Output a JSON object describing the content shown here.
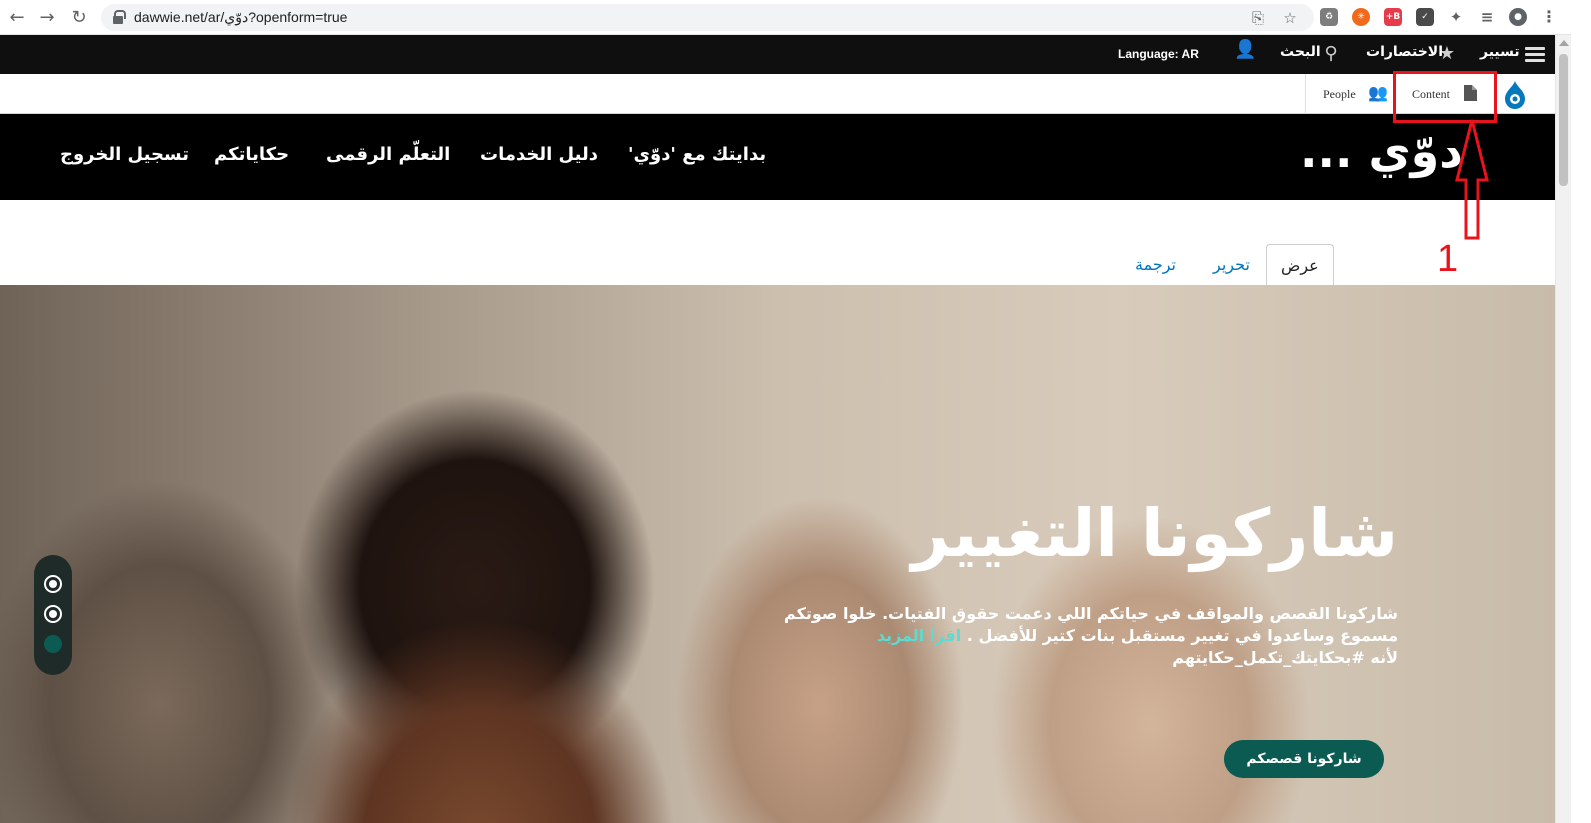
{
  "browser": {
    "url": "dawwie.net/ar/دوّي?openform=true"
  },
  "admin_toolbar": {
    "manage": "تسيير",
    "shortcuts": "الاختصارات",
    "search": "البحث",
    "language": "Language: AR"
  },
  "admin_tray": {
    "content": "Content",
    "people": "People"
  },
  "site": {
    "logo": "دوّي ...",
    "nav": [
      "بدايتك مع 'دوّي'",
      "دليل الخدمات",
      "التعلّم الرقمى",
      "حكاياتكم",
      "تسجيل الخروج"
    ]
  },
  "tabs": {
    "view": "عرض",
    "edit": "تحرير",
    "translate": "ترجمة"
  },
  "annotation": {
    "number": "1",
    "color": "#e8141d"
  },
  "hero": {
    "title": "شاركونا التغيير",
    "text": "شاركونا القصص والمواقف في حياتكم اللي دعمت حقوق الفتيات. خلوا صوتكم مسموع وساعدوا في تغيير مستقبل بنات كتير للأفضل .",
    "read_more": "اقرأ المزيد",
    "hashtag": "لأنه #بحكايتك_تكمل_حكايتهم",
    "cta": "شاركونا قصصكم",
    "accent": "#0b5b53"
  }
}
